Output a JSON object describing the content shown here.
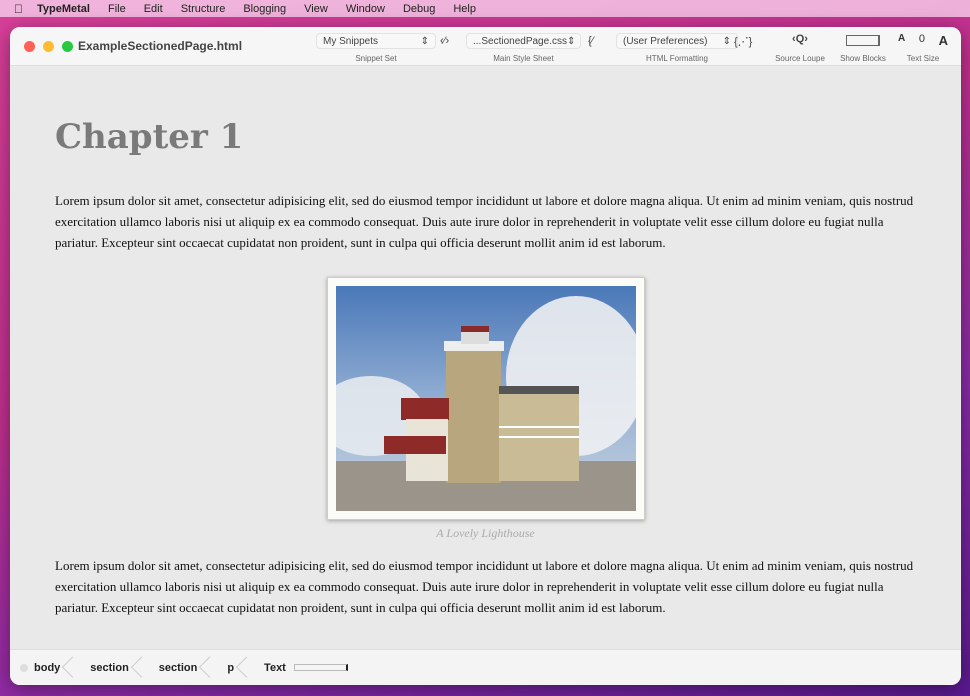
{
  "menubar": {
    "app": "TypeMetal",
    "items": [
      "File",
      "Edit",
      "Structure",
      "Blogging",
      "View",
      "Window",
      "Debug",
      "Help"
    ]
  },
  "window": {
    "title": "ExampleSectionedPage.html"
  },
  "toolbar": {
    "snippet_set": {
      "value": "My Snippets",
      "label": "Snippet Set"
    },
    "style_sheet": {
      "value": "...SectionedPage.css",
      "label": "Main Style Sheet"
    },
    "html_formatting": {
      "value": "(User Preferences)",
      "label": "HTML Formatting"
    },
    "source_loupe": {
      "label": "Source Loupe"
    },
    "show_blocks": {
      "label": "Show Blocks"
    },
    "text_size": {
      "label": "Text Size",
      "smaller": "A",
      "reset": "0",
      "larger": "A"
    }
  },
  "document": {
    "heading": "Chapter 1",
    "para1": "Lorem ipsum dolor sit amet, consectetur adipisicing elit, sed do eiusmod tempor incididunt ut labore et dolore magna aliqua. Ut enim ad minim veniam, quis nostrud exercitation ullamco laboris nisi ut aliquip ex ea commodo consequat. Duis aute irure dolor in reprehenderit in voluptate velit esse cillum dolore eu fugiat nulla pariatur. Excepteur sint occaecat cupidatat non proident, sunt in culpa qui officia deserunt mollit anim id est laborum.",
    "caption": "A Lovely Lighthouse",
    "para2": "Lorem ipsum dolor sit amet, consectetur adipisicing elit, sed do eiusmod tempor incididunt ut labore et dolore magna aliqua. Ut enim ad minim veniam, quis nostrud exercitation ullamco laboris nisi ut aliquip ex ea commodo consequat. Duis aute irure dolor in reprehenderit in voluptate velit esse cillum dolore eu fugiat nulla pariatur. Excepteur sint occaecat cupidatat non proident, sunt in culpa qui officia deserunt mollit anim id est laborum."
  },
  "breadcrumb": [
    "body",
    "section",
    "section",
    "p",
    "Text"
  ]
}
